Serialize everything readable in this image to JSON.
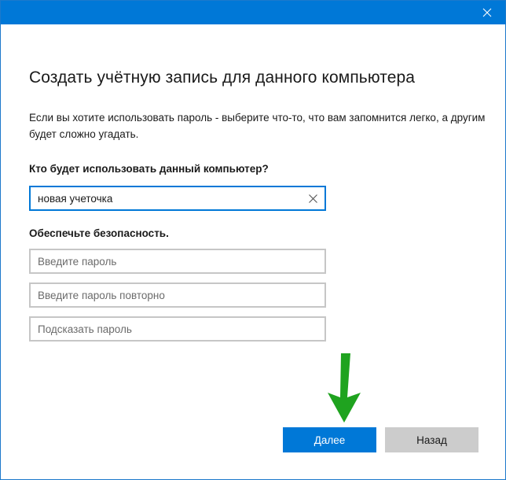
{
  "window": {
    "close_icon": "close-icon",
    "accent_color": "#0078d7"
  },
  "title": "Создать учётную запись для данного компьютера",
  "description": "Если вы хотите использовать пароль - выберите что-то, что вам запомнится легко, а другим будет сложно угадать.",
  "username_section": {
    "label": "Кто будет использовать данный компьютер?",
    "value": "новая учеточка",
    "clear_icon": "clear-x-icon"
  },
  "security_section": {
    "label": "Обеспечьте безопасность.",
    "password_placeholder": "Введите пароль",
    "password_repeat_placeholder": "Введите пароль повторно",
    "hint_placeholder": "Подсказать пароль"
  },
  "buttons": {
    "next_label": "Далее",
    "back_label": "Назад"
  },
  "annotation": {
    "arrow_icon": "green-down-arrow-icon",
    "arrow_color": "#1fa31f"
  }
}
